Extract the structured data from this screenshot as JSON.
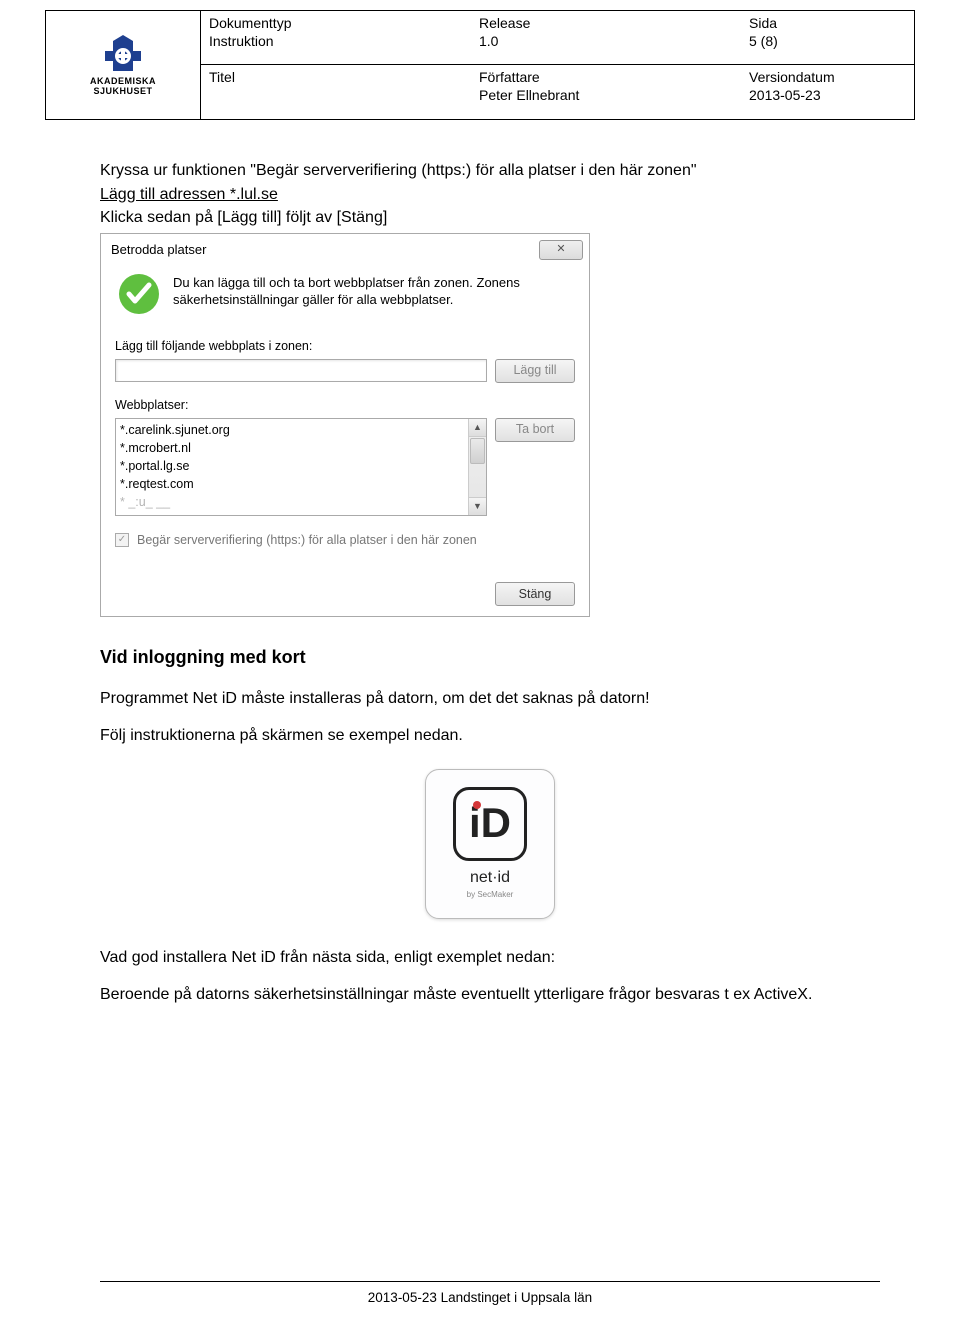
{
  "header": {
    "logo_line1": "AKADEMISKA",
    "logo_line2": "SJUKHUSET",
    "doctype_label": "Dokumenttyp",
    "doctype_value": "Instruktion",
    "release_label": "Release",
    "release_value": "1.0",
    "page_label": "Sida",
    "page_value": "5 (8)",
    "title_label": "Titel",
    "author_label": "Författare",
    "author_value": "Peter Ellnebrant",
    "versiondate_label": "Versiondatum",
    "versiondate_value": "2013-05-23"
  },
  "body": {
    "p1": "Kryssa ur funktionen \"Begär serververifiering (https:) för alla platser i den här zonen\"",
    "p2": "Lägg till adressen *.lul.se",
    "p3": "Klicka sedan på [Lägg till] följt av [Stäng]",
    "section_h": "Vid inloggning med kort",
    "p4": "Programmet Net iD måste installeras på datorn, om det det saknas på datorn!",
    "p5": "Följ instruktionerna på skärmen se exempel nedan.",
    "p6": "Vad god installera Net iD från nästa sida, enligt exemplet nedan:",
    "p7": "Beroende på datorns säkerhetsinställningar måste eventuellt ytterligare frågor besvaras t ex ActiveX."
  },
  "dialog": {
    "title": "Betrodda platser",
    "close": "✕",
    "desc": "Du kan lägga till och ta bort webbplatser från zonen. Zonens säkerhetsinställningar gäller för alla webbplatser.",
    "add_label": "Lägg till följande webbplats i zonen:",
    "add_button": "Lägg till",
    "list_label": "Webbplatser:",
    "items": [
      "*.carelink.sjunet.org",
      "*.mcrobert.nl",
      "*.portal.lg.se",
      "*.reqtest.com",
      "* _:u_ __"
    ],
    "remove_button": "Ta bort",
    "checkbox": "Begär serververifiering (https:) för alla platser i den här zonen",
    "close_button": "Stäng"
  },
  "netid": {
    "label": "net·id",
    "sub": "by SecMaker"
  },
  "footer": "2013-05-23 Landstinget i Uppsala län"
}
